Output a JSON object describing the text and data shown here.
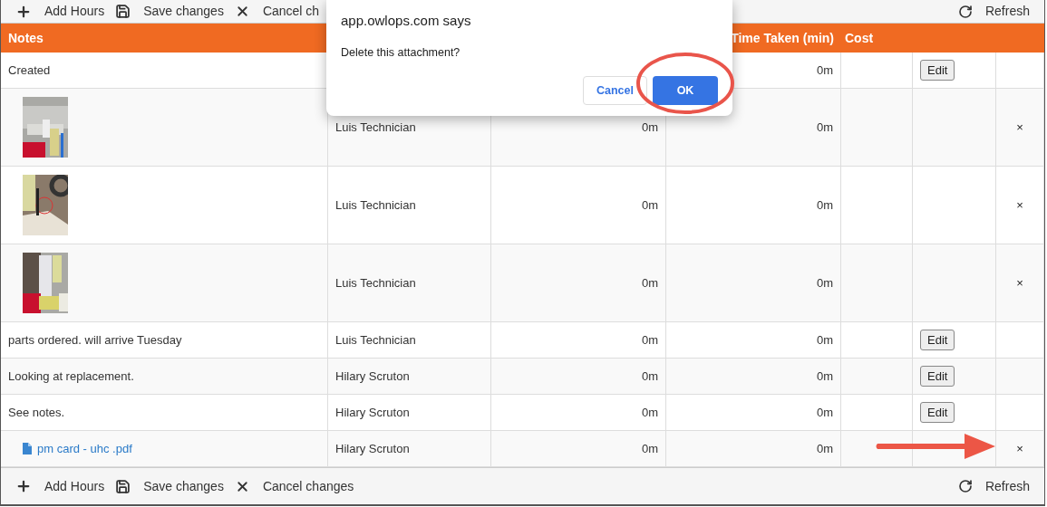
{
  "toolbar_top": {
    "actions": [
      {
        "kind": "add",
        "label": "Add Hours"
      },
      {
        "kind": "save",
        "label": "Save changes"
      },
      {
        "kind": "cancel",
        "label": "Cancel ch"
      }
    ],
    "refresh": "Refresh"
  },
  "table": {
    "columns": {
      "notes": "Notes",
      "time_taken": "Time Taken (min)",
      "cost": "Cost"
    },
    "rows": [
      {
        "kind": "text",
        "notes": "Created",
        "time_taken": "0m",
        "edit": "Edit"
      },
      {
        "column_2": "Luis Technician",
        "column_3": "0m",
        "time_taken": "0m",
        "delete": "×"
      },
      {
        "column_2": "Luis Technician",
        "column_3": "0m",
        "time_taken": "0m",
        "delete": "×"
      },
      {
        "column_2": "Luis Technician",
        "column_3": "0m",
        "time_taken": "0m",
        "delete": "×"
      },
      {
        "kind": "text",
        "notes": "parts ordered. will arrive Tuesday",
        "column_2": "Luis Technician",
        "column_3": "0m",
        "time_taken": "0m",
        "edit": "Edit"
      },
      {
        "kind": "text",
        "notes": "Looking at replacement.",
        "column_2": "Hilary Scruton",
        "column_3": "0m",
        "time_taken": "0m",
        "edit": "Edit"
      },
      {
        "kind": "text",
        "notes": "See notes.",
        "column_2": "Hilary Scruton",
        "column_3": "0m",
        "time_taken": "0m",
        "edit": "Edit"
      },
      {
        "kind": "file",
        "notes": "pm card - uhc .pdf",
        "column_2": "Hilary Scruton",
        "column_3": "0m",
        "time_taken": "0m",
        "delete": "×"
      }
    ]
  },
  "toolbar_bottom": {
    "actions": [
      {
        "kind": "add",
        "label": "Add Hours"
      },
      {
        "kind": "save",
        "label": "Save changes"
      },
      {
        "kind": "cancel",
        "label": "Cancel changes"
      }
    ],
    "refresh": "Refresh"
  },
  "dialog": {
    "origin": "app.owlops.com says",
    "message": "Delete this attachment?",
    "buttons": [
      {
        "kind": "secondary",
        "label": "Cancel"
      },
      {
        "kind": "primary",
        "label": "OK"
      }
    ]
  }
}
